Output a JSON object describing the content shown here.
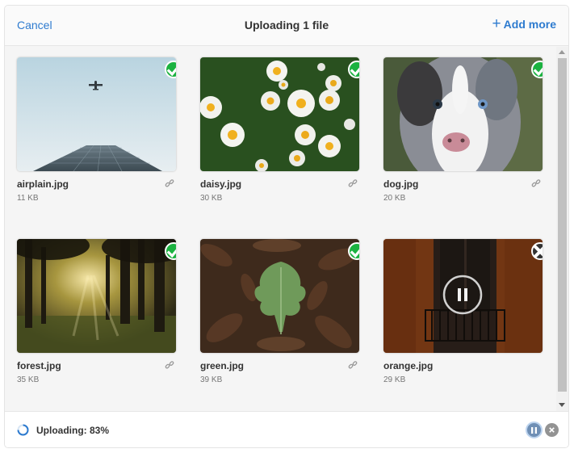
{
  "header": {
    "cancel_label": "Cancel",
    "title": "Uploading 1 file",
    "add_more_label": "Add more"
  },
  "files": [
    {
      "name": "airplain.jpg",
      "size": "11 KB",
      "status": "complete",
      "thumb": "airplane-over-skyscraper"
    },
    {
      "name": "daisy.jpg",
      "size": "30 KB",
      "status": "complete",
      "thumb": "daisies-in-grass"
    },
    {
      "name": "dog.jpg",
      "size": "20 KB",
      "status": "complete",
      "thumb": "australian-shepherd-puppy"
    },
    {
      "name": "forest.jpg",
      "size": "35 KB",
      "status": "complete",
      "thumb": "sunlit-forest"
    },
    {
      "name": "green.jpg",
      "size": "39 KB",
      "status": "complete",
      "thumb": "green-leaf-on-brown-leaves"
    },
    {
      "name": "orange.jpg",
      "size": "29 KB",
      "status": "uploading",
      "thumb": "orange-wall-window-balcony"
    }
  ],
  "status": {
    "text": "Uploading: 83%",
    "progress_percent": 83
  },
  "colors": {
    "accent": "#2e7bcf",
    "success": "#1bb240",
    "remove": "#333333"
  },
  "icons": {
    "complete": "check-circle-icon",
    "remove": "close-circle-icon",
    "link": "link-icon",
    "pause": "pause-icon",
    "spinner": "loading-spinner-icon"
  }
}
